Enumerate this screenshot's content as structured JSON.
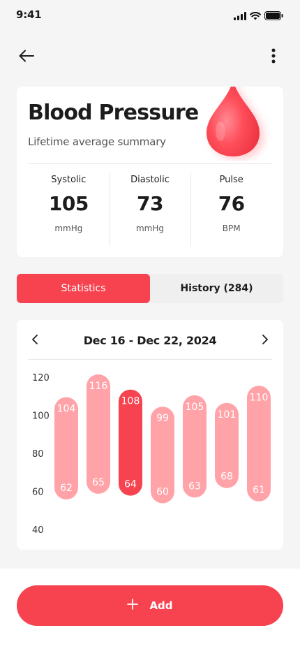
{
  "status_bar": {
    "time": "9:41",
    "icons": [
      "signal-icon",
      "wifi-icon",
      "battery-icon"
    ]
  },
  "topbar": {
    "back_icon": "arrow-left-icon",
    "more_icon": "more-vertical-icon"
  },
  "summary": {
    "title": "Blood Pressure",
    "subtitle": "Lifetime average summary",
    "metrics": [
      {
        "label": "Systolic",
        "value": "105",
        "unit": "mmHg"
      },
      {
        "label": "Diastolic",
        "value": "73",
        "unit": "mmHg"
      },
      {
        "label": "Pulse",
        "value": "76",
        "unit": "BPM"
      }
    ]
  },
  "tabs": [
    {
      "label": "Statistics",
      "active": true
    },
    {
      "label": "History (284)",
      "active": false
    }
  ],
  "chart_header": {
    "date_range": "Dec 16 - Dec 22, 2024"
  },
  "chart_data": {
    "type": "bar",
    "ylim": [
      40,
      120
    ],
    "y_ticks": [
      120,
      100,
      80,
      60,
      40
    ],
    "highlight_index": 2,
    "ranges": [
      {
        "systolic": 104,
        "diastolic": 62
      },
      {
        "systolic": 116,
        "diastolic": 65
      },
      {
        "systolic": 108,
        "diastolic": 64
      },
      {
        "systolic": 99,
        "diastolic": 60
      },
      {
        "systolic": 105,
        "diastolic": 63
      },
      {
        "systolic": 101,
        "diastolic": 68
      },
      {
        "systolic": 110,
        "diastolic": 61
      }
    ]
  },
  "colors": {
    "accent": "#f7434f",
    "bar": "#ffa3a8",
    "bar_highlight": "#f7434f",
    "background": "#f5f5f5"
  },
  "add_button": {
    "label": "Add",
    "icon": "plus-icon"
  }
}
